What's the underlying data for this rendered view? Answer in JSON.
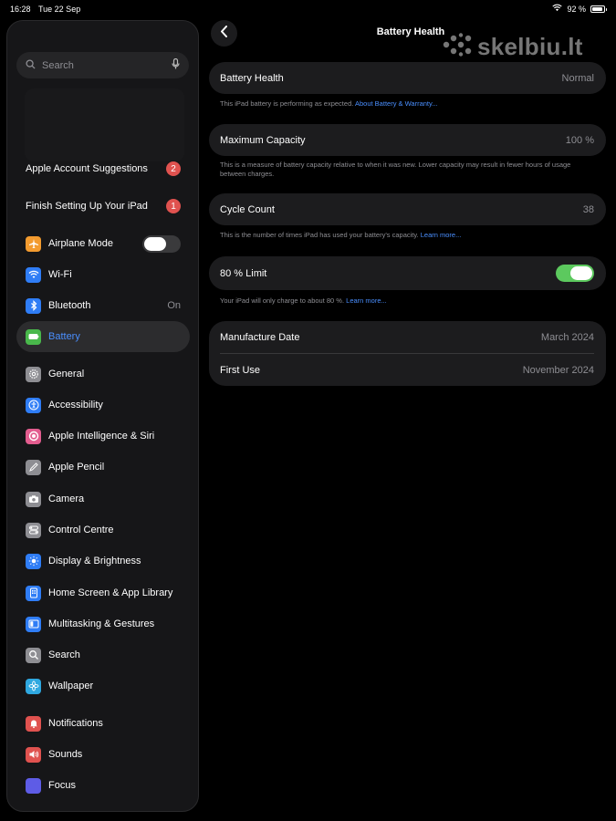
{
  "status": {
    "time": "16:28",
    "date": "Tue 22 Sep",
    "battery": "92 %",
    "battery_level": 0.92
  },
  "sidebar": {
    "search_placeholder": "Search",
    "suggestions": [
      {
        "label": "Apple Account Suggestions",
        "badge": "2"
      },
      {
        "label": "Finish Setting Up Your iPad",
        "badge": "1"
      }
    ],
    "group1": [
      {
        "label": "Airplane Mode",
        "icon": "airplane-icon",
        "color": "#f39b2f"
      },
      {
        "label": "Wi-Fi",
        "icon": "wifi-icon",
        "color": "#2f7df6"
      },
      {
        "label": "Bluetooth",
        "icon": "bluetooth-icon",
        "color": "#2f7df6",
        "value": "On"
      },
      {
        "label": "Battery",
        "icon": "battery-icon",
        "color": "#49b84b",
        "selected": true
      }
    ],
    "group2": [
      {
        "label": "General",
        "icon": "gear-icon",
        "color": "#8e8e93"
      },
      {
        "label": "Accessibility",
        "icon": "accessibility-icon",
        "color": "#2f7df6"
      },
      {
        "label": "Apple Intelligence & Siri",
        "icon": "siri-icon",
        "color": "#e35d8f"
      },
      {
        "label": "Apple Pencil",
        "icon": "pencil-icon",
        "color": "#8e8e93"
      },
      {
        "label": "Camera",
        "icon": "camera-icon",
        "color": "#8e8e93"
      },
      {
        "label": "Control Centre",
        "icon": "switches-icon",
        "color": "#8e8e93"
      },
      {
        "label": "Display & Brightness",
        "icon": "sun-icon",
        "color": "#2f7df6"
      },
      {
        "label": "Home Screen & App Library",
        "icon": "homescreen-icon",
        "color": "#2f7df6"
      },
      {
        "label": "Multitasking & Gestures",
        "icon": "multitasking-icon",
        "color": "#2f7df6"
      },
      {
        "label": "Search",
        "icon": "search-icon",
        "color": "#8e8e93"
      },
      {
        "label": "Wallpaper",
        "icon": "flower-icon",
        "color": "#2fa8e0"
      }
    ],
    "group3": [
      {
        "label": "Notifications",
        "icon": "bell-icon",
        "color": "#e0524f"
      },
      {
        "label": "Sounds",
        "icon": "speaker-icon",
        "color": "#e0524f"
      },
      {
        "label": "Focus",
        "icon": "moon-icon",
        "color": "#5e5ce6"
      }
    ]
  },
  "header": {
    "title": "Battery Health",
    "watermark": "skelbiu.lt"
  },
  "health": {
    "label": "Battery Health",
    "value": "Normal",
    "note": "This iPad battery is performing as expected.",
    "note_link": "About Battery & Warranty..."
  },
  "capacity": {
    "label": "Maximum Capacity",
    "value": "100 %",
    "note": "This is a measure of battery capacity relative to when it was new. Lower capacity may result in fewer hours of usage between charges."
  },
  "cycles": {
    "label": "Cycle Count",
    "value": "38",
    "note": "This is the number of times iPad has used your battery's capacity.",
    "note_link": "Learn more..."
  },
  "limit": {
    "label": "80 % Limit",
    "enabled": true,
    "note": "Your iPad will only charge to about 80 %.",
    "note_link": "Learn more..."
  },
  "dates": {
    "manufacture_label": "Manufacture Date",
    "manufacture_value": "March 2024",
    "first_use_label": "First Use",
    "first_use_value": "November 2024"
  }
}
